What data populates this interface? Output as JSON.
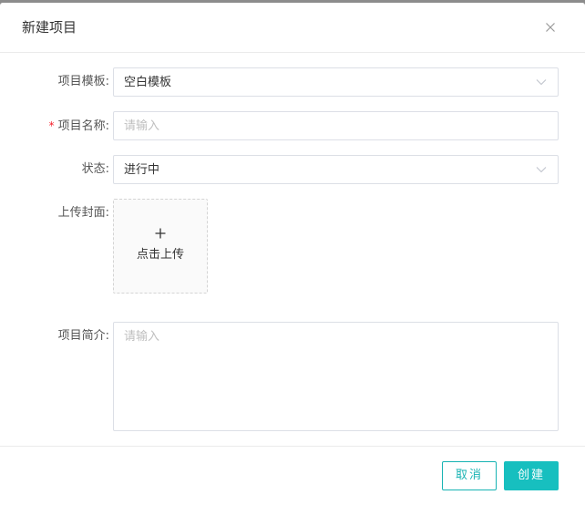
{
  "modal": {
    "title": "新建项目",
    "close_icon": "close-icon"
  },
  "form": {
    "template": {
      "label": "项目模板",
      "colon": ":",
      "value": "空白模板"
    },
    "name": {
      "required_mark": "*",
      "label": "项目名称",
      "colon": ":",
      "placeholder": "请输入",
      "value": ""
    },
    "status": {
      "label": "状态",
      "colon": ":",
      "value": "进行中"
    },
    "cover": {
      "label": "上传封面",
      "colon": ":",
      "upload_text": "点击上传",
      "icon": "plus-icon"
    },
    "description": {
      "label": "项目简介",
      "colon": ":",
      "placeholder": "请输入",
      "value": ""
    }
  },
  "footer": {
    "cancel_label": "取消",
    "create_label": "创建"
  },
  "colors": {
    "accent": "#17bfbf",
    "required": "#f5222d",
    "border": "#dcdfe6"
  }
}
